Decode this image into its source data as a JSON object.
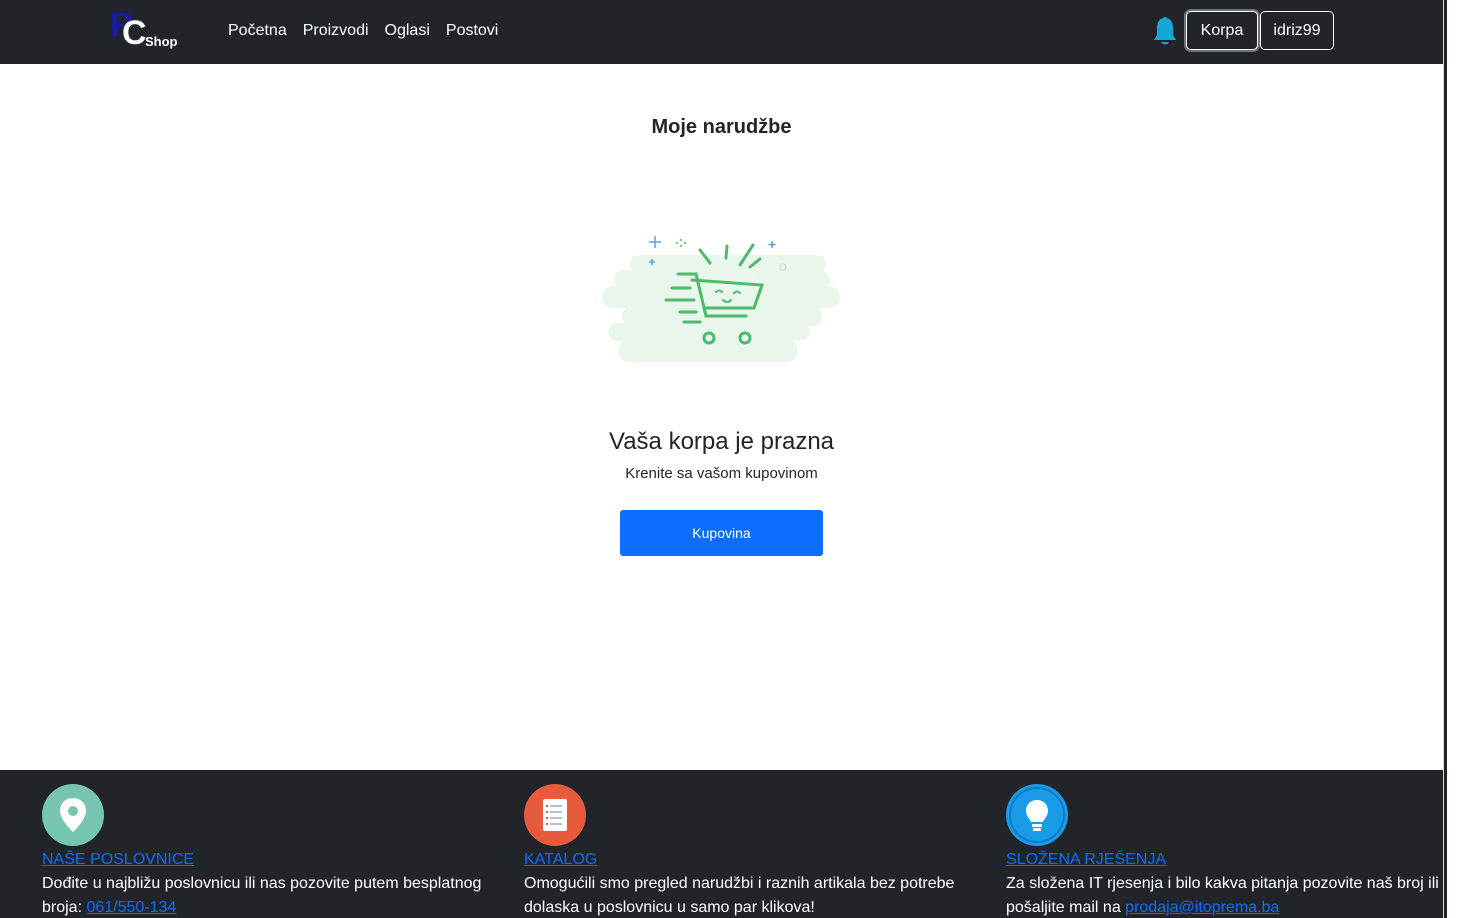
{
  "navbar": {
    "logo": {
      "p": "P",
      "c": "C",
      "shop": "Shop"
    },
    "links": [
      "Početna",
      "Proizvodi",
      "Oglasi",
      "Postovi"
    ],
    "bell_icon": "bell-icon",
    "cart_button": "Korpa",
    "user_button": "idriz99"
  },
  "main": {
    "title": "Moje narudžbe",
    "illustration": "empty-cart-illustration",
    "empty_title": "Vaša korpa je prazna",
    "empty_subtitle": "Krenite sa vašom kupovinom",
    "shop_button": "Kupovina"
  },
  "footer": {
    "columns": [
      {
        "icon": "location-pin-icon",
        "heading": "NAŠE POSLOVNICE",
        "text": "Dođite u najbližu poslovnicu ili nas pozovite putem besplatnog broja: ",
        "link": "061/550-134"
      },
      {
        "icon": "document-list-icon",
        "heading": "KATALOG",
        "text": "Omogućili smo pregled narudžbi i raznih artikala bez potrebe dolaska u poslovnicu u samo par klikova!",
        "link": ""
      },
      {
        "icon": "lightbulb-icon",
        "heading": "SLOŽENA RJEŠENJA",
        "text": "Za složena IT rjesenja i bilo kakva pitanja pozovite naš broj ili pošaljite mail na ",
        "link": "prodaja@itoprema.ba"
      }
    ]
  },
  "colors": {
    "navbar_bg": "#212529",
    "primary": "#0d6efd",
    "cart_green": "#4cbb6c",
    "location_teal": "#76c5b0",
    "catalog_red": "#e85a3c",
    "idea_blue": "#1a9be8"
  }
}
